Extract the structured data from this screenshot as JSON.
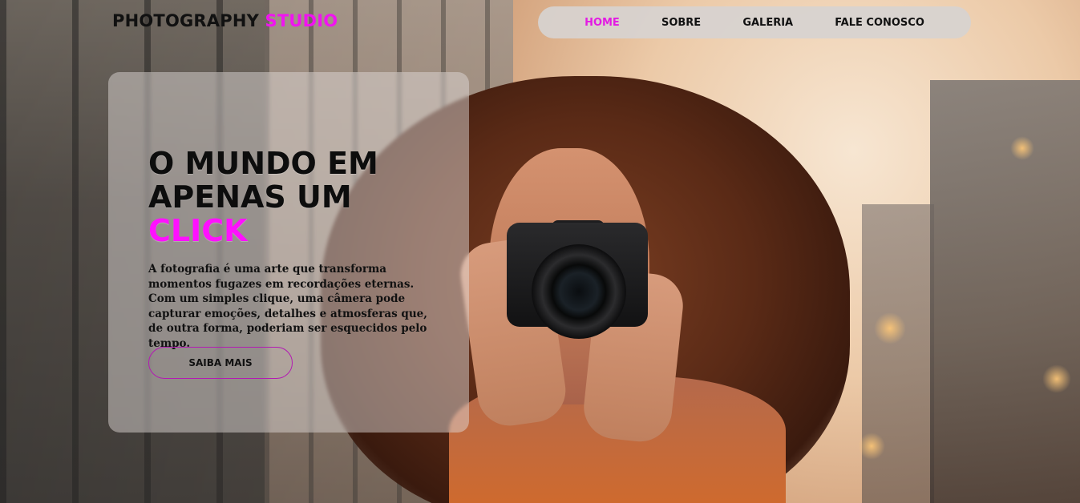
{
  "header": {
    "logo_main": "PHOTOGRAPHY",
    "logo_accent": "STUDIO",
    "nav": [
      "HOME",
      "SOBRE",
      "GALERIA",
      "FALE CONOSCO"
    ],
    "active_nav": "HOME"
  },
  "hero": {
    "headline_line1": "O MUNDO EM",
    "headline_line2": "APENAS UM",
    "headline_accent": "CLICK",
    "description": "A fotografia é uma arte que transforma momentos fugazes em recordações eternas. Com um simples clique, uma câmera pode capturar emoções, detalhes e atmosferas que, de outra forma, poderiam ser esquecidos pelo tempo.",
    "cta_label": "SAIBA MAIS"
  },
  "colors": {
    "accent": "#f014f0",
    "text": "#111111",
    "nav_bg": "#d7d2d0"
  }
}
